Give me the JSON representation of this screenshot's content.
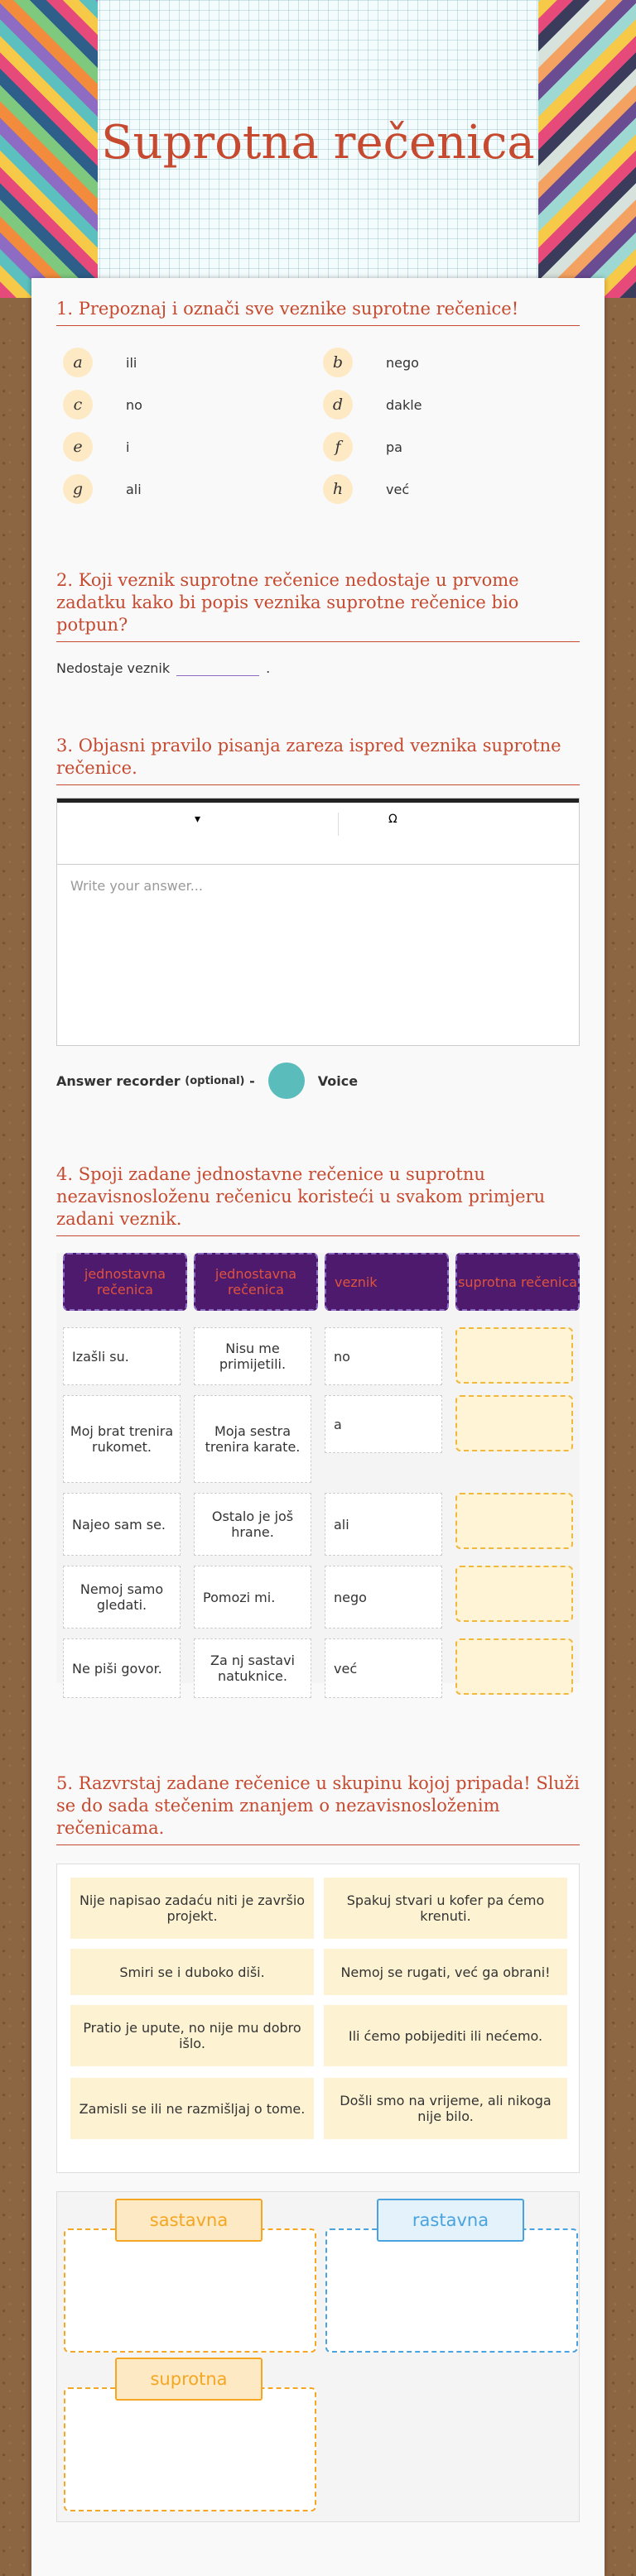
{
  "page": {
    "title": "Suprotna rečenica"
  },
  "q1": {
    "heading": "1. Prepoznaj i označi sve veznike suprotne rečenice!",
    "options": [
      {
        "letter": "a",
        "text": "ili"
      },
      {
        "letter": "b",
        "text": "nego"
      },
      {
        "letter": "c",
        "text": "no"
      },
      {
        "letter": "d",
        "text": "dakle"
      },
      {
        "letter": "e",
        "text": "i"
      },
      {
        "letter": "f",
        "text": "pa"
      },
      {
        "letter": "g",
        "text": "ali"
      },
      {
        "letter": "h",
        "text": "već"
      }
    ]
  },
  "q2": {
    "heading": "2. Koji veznik suprotne rečenice nedostaje u prvome zadatku kako bi popis veznika suprotne rečenice bio potpun?",
    "prefix": "Nedostaje veznik",
    "suffix": "."
  },
  "q3": {
    "heading": "3. Objasni pravilo pisanja zareza ispred veznika suprotne rečenice.",
    "dropdown_icon": "▾",
    "omega": "Ω",
    "placeholder": "Write your answer...",
    "recorder_label": "Answer recorder",
    "recorder_optional": "(optional)",
    "recorder_dash": "-",
    "voice": "Voice"
  },
  "q4": {
    "heading": "4. Spoji zadane jednostavne rečenice u suprotnu nezavisnosloženu rečenicu koristeći u svakom primjeru zadani veznik.",
    "headers": [
      "jednostavna rečenica",
      "jednostavna rečenica",
      "veznik",
      "suprotna rečenica"
    ],
    "rows": [
      [
        "Izašli su.",
        "Nisu me primijetili.",
        "no"
      ],
      [
        "Moj brat trenira rukomet.",
        "Moja sestra trenira karate.",
        "a"
      ],
      [
        "Najeo sam se.",
        "Ostalo je još hrane.",
        "ali"
      ],
      [
        "Nemoj samo gledati.",
        "Pomozi mi.",
        "nego"
      ],
      [
        "Ne piši govor.",
        "Za nj sastavi natuknice.",
        "već"
      ]
    ]
  },
  "q5": {
    "heading": "5. Razvrstaj zadane rečenice u skupinu kojoj pripada! Služi se do sada stečenim znanjem o nezavisnosloženim rečenicama.",
    "cards": [
      "Nije napisao zadaću niti je završio projekt.",
      "Spakuj stvari u kofer pa ćemo krenuti.",
      "Smiri se i duboko diši.",
      "Nemoj se rugati, već ga obrani!",
      "Pratio je upute, no nije mu dobro išlo.",
      "Ili ćemo pobijediti ili nećemo.",
      "Zamisli se ili ne razmišljaj o tome.",
      "Došli smo na vrijeme, ali nikoga nije bilo."
    ],
    "groups": [
      "sastavna",
      "rastavna",
      "suprotna"
    ],
    "colors": {
      "sastavna": "#f5a623",
      "rastavna": "#4aa3df",
      "suprotna": "#f5a623"
    }
  }
}
